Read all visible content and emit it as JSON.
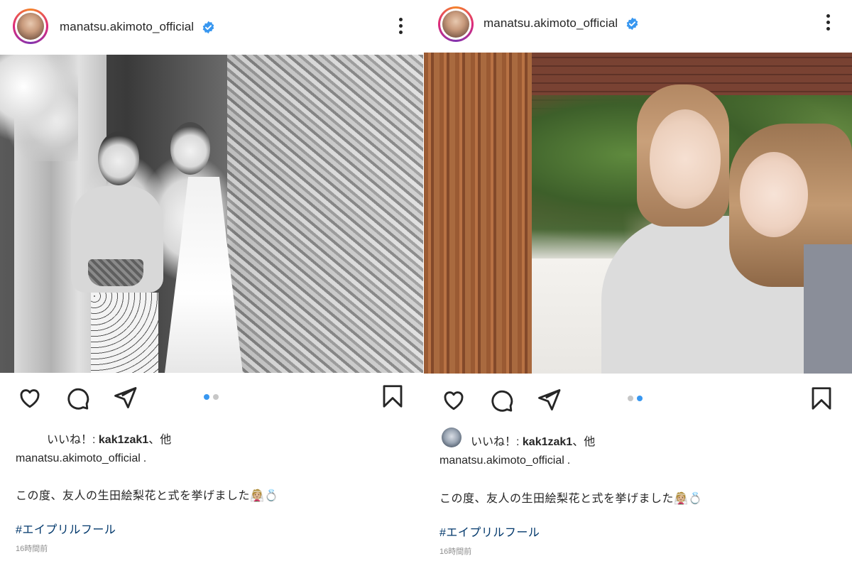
{
  "posts": [
    {
      "username": "manatsu.akimoto_official",
      "likes_prefix": "いいね！: ",
      "liked_by": "kak1zak1",
      "likes_suffix": "、他",
      "caption_user": "manatsu.akimoto_official",
      "caption_period": ".",
      "caption_text": "この度、友人の生田絵梨花と式を挙げました👰🏼💍",
      "hashtag": "#エイプリルフール",
      "timestamp": "16時間前",
      "carousel": {
        "count": 2,
        "active": 1
      }
    },
    {
      "username": "manatsu.akimoto_official",
      "likes_prefix": "いいね！: ",
      "liked_by": "kak1zak1",
      "likes_suffix": "、他",
      "caption_user": "manatsu.akimoto_official",
      "caption_period": ".",
      "caption_text": "この度、友人の生田絵梨花と式を挙げました👰🏼💍",
      "hashtag": "#エイプリルフール",
      "timestamp": "16時間前",
      "carousel": {
        "count": 2,
        "active": 2
      }
    }
  ],
  "icons": {
    "verified": "verified-badge-icon",
    "more": "more-options-icon",
    "like": "heart-icon",
    "comment": "comment-icon",
    "share": "send-icon",
    "save": "bookmark-icon"
  },
  "colors": {
    "verified": "#3897f0",
    "active_dot": "#3897f0",
    "inactive_dot": "#c7c7c7",
    "hashtag": "#00376b",
    "timestamp": "#8e8e8e"
  }
}
